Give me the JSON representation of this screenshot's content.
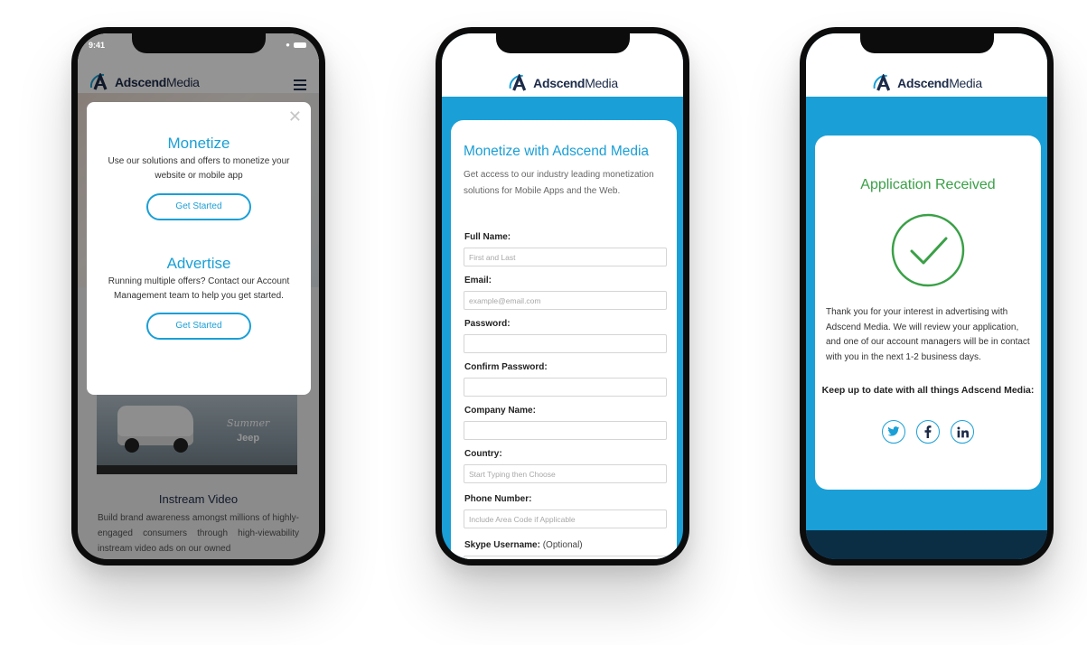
{
  "status": {
    "time": "9:41"
  },
  "brand": {
    "name_bold": "Adscend",
    "name_light": "Media"
  },
  "phone1": {
    "modal": {
      "monetize": {
        "title": "Monetize",
        "text": "Use our solutions and offers to monetize your website or mobile app",
        "button": "Get Started"
      },
      "advertise": {
        "title": "Advertise",
        "text": "Running multiple offers?  Contact our Account Management team to help you get started.",
        "button": "Get Started"
      }
    },
    "video": {
      "summer": "Summer",
      "jeep": "Jeep"
    },
    "section": {
      "title": "Instream Video",
      "text": "Build brand awareness amongst millions of highly-engaged consumers through high-viewability instream video ads on our owned"
    }
  },
  "phone2": {
    "title": "Monetize with Adscend Media",
    "intro": "Get access to our industry leading monetization solutions for Mobile Apps and the Web.",
    "fields": [
      {
        "label": "Full Name:",
        "placeholder": "First and Last"
      },
      {
        "label": "Email:",
        "placeholder": "example@email.com"
      },
      {
        "label": "Password:",
        "placeholder": ""
      },
      {
        "label": "Confirm Password:",
        "placeholder": ""
      },
      {
        "label": "Company Name:",
        "placeholder": ""
      },
      {
        "label": "Country:",
        "placeholder": "Start Typing then Choose"
      },
      {
        "label": "Phone Number:",
        "placeholder": "Include Area Code if Applicable"
      },
      {
        "label": "Skype Username:",
        "optional": "(Optional)",
        "placeholder": ""
      }
    ]
  },
  "phone3": {
    "title": "Application Received",
    "message": "Thank you for your interest in advertising with Adscend Media. We will review your application, and one of our account managers will be in contact with you in the next 1-2 business days.",
    "keep_up": "Keep up to date with all things Adscend Media:",
    "socials": [
      "twitter-icon",
      "facebook-icon",
      "linkedin-icon"
    ]
  },
  "colors": {
    "accent": "#1a9fd6",
    "navy": "#1c2b49",
    "success": "#3aa047",
    "footer": "#0b2e45"
  }
}
